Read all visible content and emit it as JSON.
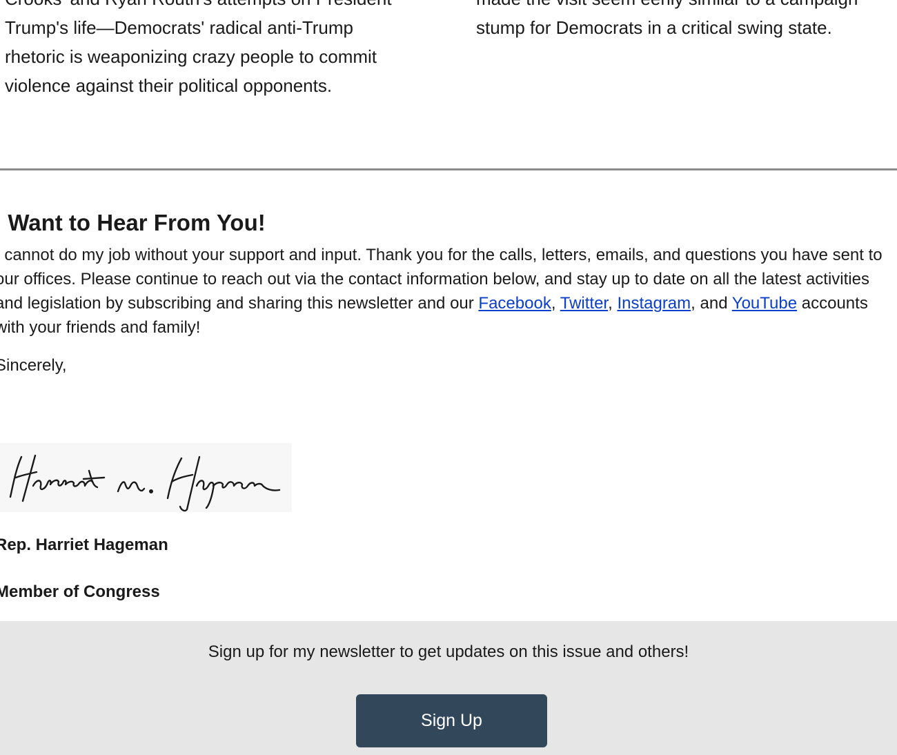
{
  "columns": {
    "left": {
      "text": "Crooks' and Ryan Routh's attempts on President Trump's life—Democrats' radical anti-Trump rhetoric is weaponizing crazy people to commit violence against their political opponents."
    },
    "right": {
      "text": "made the visit seem eerily similar to a campaign stump for Democrats in a critical swing state."
    }
  },
  "letter": {
    "heading": "I Want to Hear From You!",
    "body_before_links": "I cannot do my job without your support and input. Thank you for the calls, letters, emails, and questions you have sent to our offices. Please continue to reach out via the contact information below, and stay up to date on all the latest activities and legislation by subscribing and sharing this newsletter and our ",
    "links": {
      "facebook": "Facebook",
      "twitter": "Twitter",
      "instagram": "Instagram",
      "youtube": "YouTube"
    },
    "sep_comma1": ", ",
    "sep_comma2": ", ",
    "sep_and": ", and ",
    "body_after_links": " accounts with your friends and family!",
    "closing": "Sincerely,",
    "signature_text": "Harriet M. Hageman",
    "signer_name": "Rep. Harriet Hageman",
    "signer_title": "Member of Congress"
  },
  "signup": {
    "prompt": "Sign up for my newsletter to get updates on this issue and others!",
    "button_label": "Sign Up"
  },
  "colors": {
    "divider": "#8a8a8a",
    "link": "#0b3ec9",
    "signup_bg": "#e6e6e6",
    "button_bg": "#33475b",
    "button_text": "#ffffff"
  }
}
